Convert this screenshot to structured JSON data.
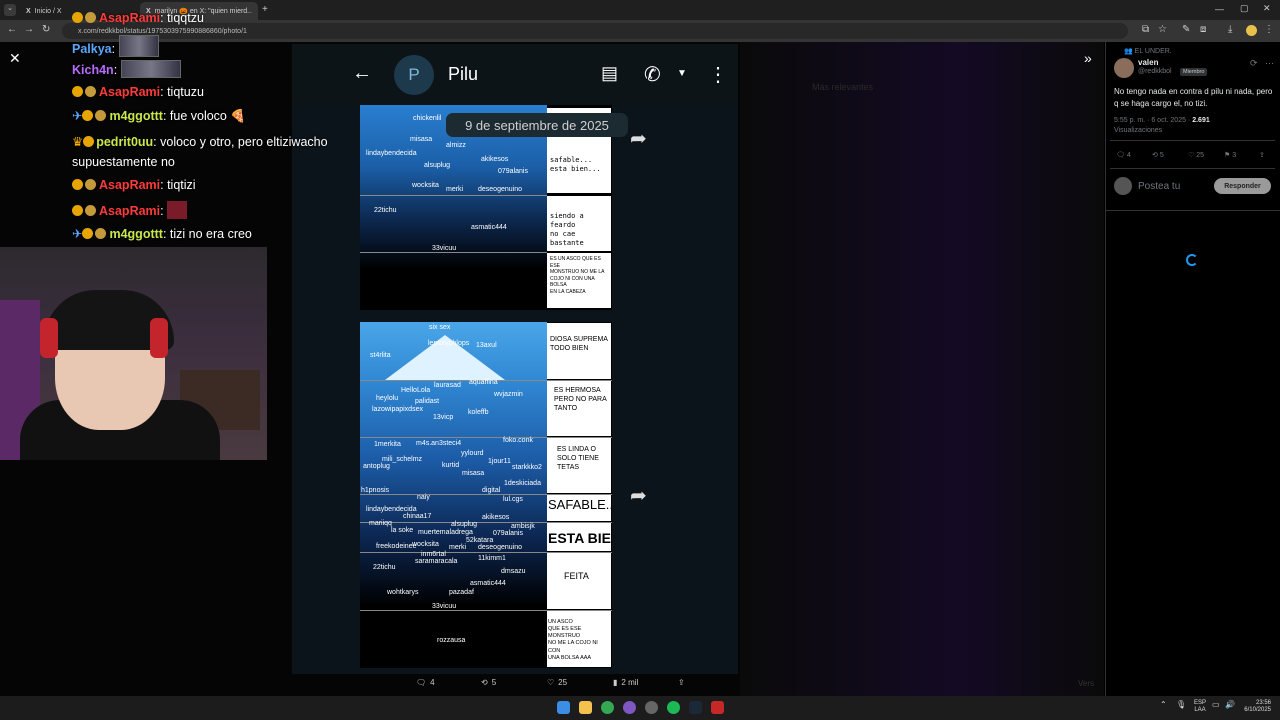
{
  "browser": {
    "tabs": [
      {
        "label": "Inicio / X"
      },
      {
        "label": "marilyn 🎃 en X: \"quien mierd..."
      }
    ],
    "url": "x.com/redkkbol/status/1975303975990886860/photo/1",
    "new_tab": "+"
  },
  "chat": [
    {
      "user": "AsapRami",
      "msg": ": tiqqtzu",
      "color": "#ff3b3b"
    },
    {
      "user": "Palkya",
      "msg": ":",
      "color": "#5aa7ff"
    },
    {
      "user": "Kich4n",
      "msg": ":",
      "color": "#b86cff"
    },
    {
      "user": "AsapRami",
      "msg": ": tiqtuzu",
      "color": "#ff3b3b"
    },
    {
      "user": "m4ggottt",
      "msg": ": fue voloco",
      "color": "#c8e84a"
    },
    {
      "user": "pedrit0uu",
      "msg": ": voloco y otro, pero eltiziwacho",
      "color": "#c8e84a"
    },
    {
      "user": "",
      "msg": "supuestamente no",
      "color": "#fff"
    },
    {
      "user": "AsapRami",
      "msg": ": tiqtizi",
      "color": "#ff3b3b"
    },
    {
      "user": "AsapRami",
      "msg": ":",
      "color": "#ff3b3b"
    },
    {
      "user": "m4ggottt",
      "msg": ": tizi no era creo",
      "color": "#c8e84a"
    }
  ],
  "whatsapp": {
    "avatar_letter": "P",
    "contact": "Pilu",
    "date_badge": "9 de septiembre de 2025"
  },
  "iceberg1": {
    "names": [
      "chickenlil",
      "misasa",
      "almizz",
      "lindaybendecida",
      "alsuplug",
      "akikesos",
      "079alanis",
      "wocksita",
      "merki",
      "deseogenuino",
      "22tichu",
      "asmatic444",
      "33vicuu"
    ],
    "side": [
      "safable...\nesta bien...",
      "siendo a feardo\nno cae bastante",
      "ES UN ASCO QUE ES ESE\nMONSTRUO NO ME LA\nCOJO NI CON UNA BOLSA\nEN LA CABEZA"
    ]
  },
  "iceberg2": {
    "names": [
      "six sex",
      "leptotyphlops",
      "13axul",
      "st4rlita",
      "laurasad",
      "aquaffina",
      "HelloLola",
      "heylolu",
      "palidast",
      "wvjazmin",
      "lazowipapixdsex",
      "13vicp",
      "koleffb",
      "1merkita",
      "m4s.an3steci4",
      "foko.conk",
      "yylourd",
      "mili_schelmz",
      "antoplug",
      "kurtid",
      "1jour11",
      "misasa",
      "starkkko2",
      "1deskiciada",
      "h1pnosis",
      "digital",
      "naiy",
      "lul.cgs",
      "lindaybendecida",
      "chinaa17",
      "akikesos",
      "mariiqq",
      "alsuplug",
      "ambisjk",
      "la soke",
      "muertemaladrega",
      "079alanis",
      "freekodeinee",
      "wocksita",
      "52katara",
      "merki",
      "deseogenuino",
      "inm6rtal",
      "saramaracala",
      "11kimm1",
      "22tichu",
      "dmsazu",
      "asmatic444",
      "wohtkarys",
      "pazadaf",
      "33vicuu",
      "rozzausa"
    ],
    "side": [
      "DIOSA SUPREMA\nTODO BIEN",
      "ES HERMOSA\nPERO NO PARA\nTANTO",
      "ES LINDA O\nSOLO TIENE\nTETAS",
      "SAFABLE...",
      "ESTA BIEN",
      "FEITA",
      "UN ASCO\nQUE ES ESE MONSTRUO\nNO ME LA COJO NI CON\nUNA BOLSA AAA"
    ]
  },
  "actions": {
    "replies": "4",
    "reposts": "5",
    "likes": "25",
    "views": "2 mil"
  },
  "right_panel": {
    "context": "EL UNDER.",
    "name": "valen",
    "handle": "@redkkbol",
    "member_badge": "Miembro",
    "text": "No tengo nada en contra d pilu ni nada, pero q se haga cargo el, no tizi.",
    "meta": "5:55 p. m. · 6 oct. 2025 ·",
    "views_count": "2.691",
    "views_label": "Visualizaciones",
    "stats": {
      "replies": "4",
      "reposts": "5",
      "likes": "25",
      "bookmarks": "3"
    },
    "reply_placeholder": "Postea tu",
    "reply_button": "Responder"
  },
  "tray": {
    "lang": "ESP",
    "layout": "LAA",
    "time": "23:56",
    "date": "6/10/2025"
  },
  "ghost_text": {
    "relevant": "Más relevantes",
    "bottom_right": "Vers"
  }
}
